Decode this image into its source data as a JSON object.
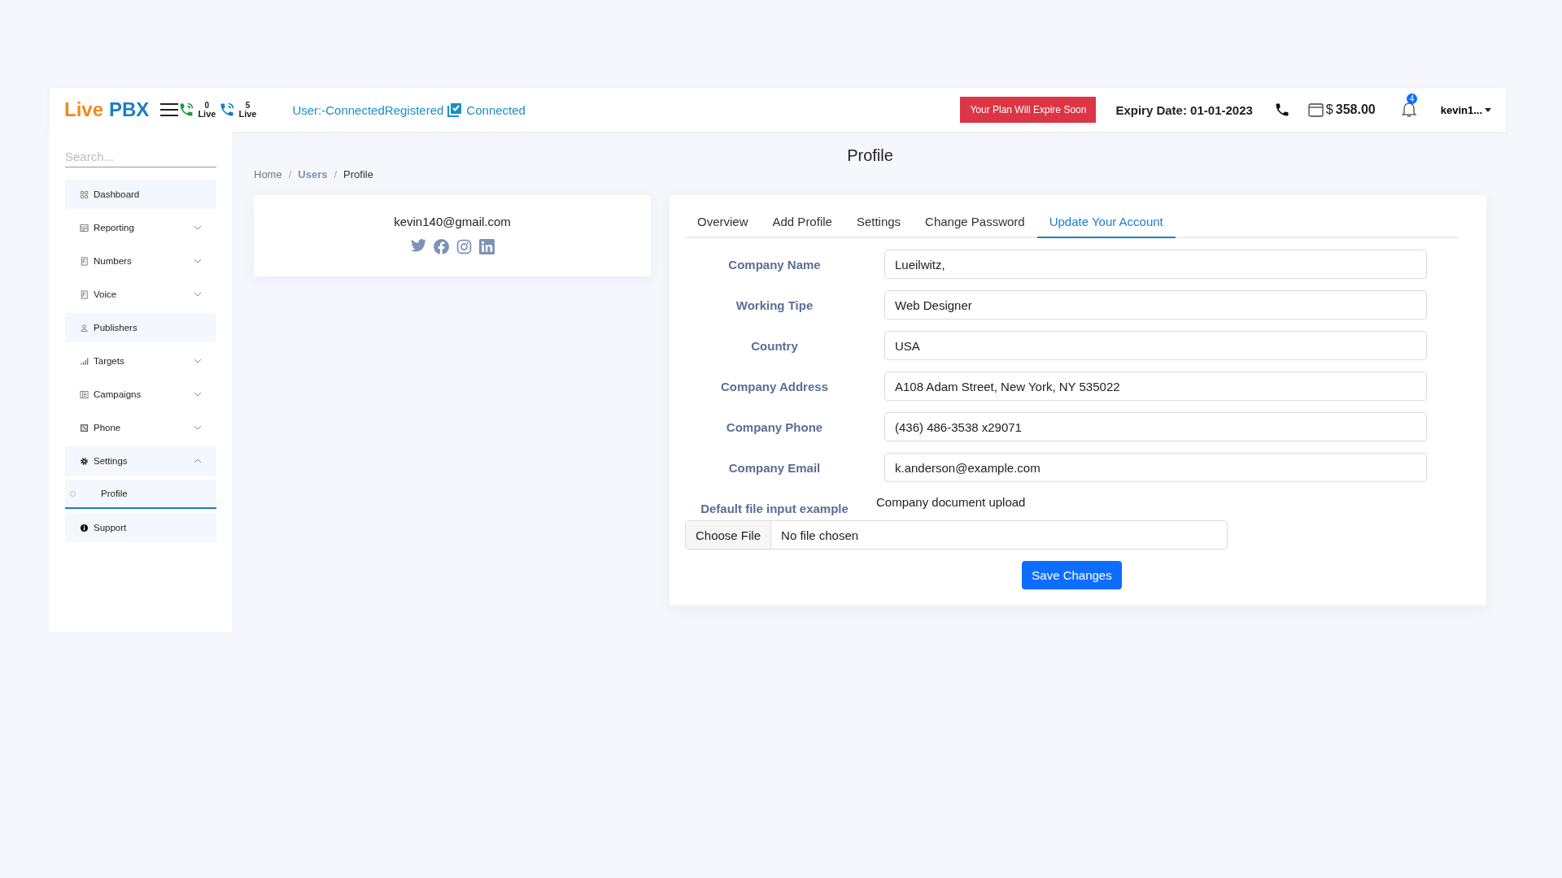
{
  "header": {
    "logo": {
      "first": "Live",
      "second": "PBX"
    },
    "live_counters": [
      {
        "count": "0",
        "label": "Live"
      },
      {
        "count": "5",
        "label": "Live"
      }
    ],
    "status": {
      "user": "User:-ConnectedRegistered",
      "connection": "Connected",
      "connected": true
    },
    "plan_button": "Your Plan Will Expire Soon",
    "expiry": "Expiry Date: 01-01-2023",
    "balance": {
      "currency": "$",
      "amount": "358.00"
    },
    "notifications": "4",
    "user": "kevin1..."
  },
  "sidebar": {
    "search": {
      "placeholder": "Search..."
    },
    "items": [
      {
        "label": "Dashboard",
        "kind": "link"
      },
      {
        "label": "Reporting",
        "kind": "group",
        "expanded": false
      },
      {
        "label": "Numbers",
        "kind": "group",
        "expanded": false
      },
      {
        "label": "Voice",
        "kind": "group",
        "expanded": false
      },
      {
        "label": "Publishers",
        "kind": "link"
      },
      {
        "label": "Targets",
        "kind": "group",
        "expanded": false
      },
      {
        "label": "Campaigns",
        "kind": "group",
        "expanded": false
      },
      {
        "label": "Phone",
        "kind": "group",
        "expanded": false
      },
      {
        "label": "Settings",
        "kind": "group",
        "expanded": true,
        "children": [
          {
            "label": "Profile",
            "selected": true
          }
        ]
      },
      {
        "label": "Support",
        "kind": "link"
      }
    ]
  },
  "page": {
    "title": "Profile",
    "breadcrumb": [
      {
        "label": "Home",
        "kind": "plain"
      },
      {
        "label": "/",
        "kind": "separator"
      },
      {
        "label": "Users",
        "kind": "link"
      },
      {
        "label": "/",
        "kind": "separator"
      },
      {
        "label": "Profile",
        "kind": "current"
      }
    ]
  },
  "profile_card": {
    "email": "kevin140@gmail.com"
  },
  "account": {
    "tabs": [
      {
        "label": "Overview",
        "selected": false
      },
      {
        "label": "Add Profile",
        "selected": false
      },
      {
        "label": "Settings",
        "selected": false
      },
      {
        "label": "Change Password",
        "selected": false
      },
      {
        "label": "Update Your Account",
        "selected": true
      }
    ],
    "fields": [
      {
        "label": "Company Name",
        "value": "Lueilwitz,"
      },
      {
        "label": "Working Tipe",
        "value": "Web Designer"
      },
      {
        "label": "Country",
        "value": "USA"
      },
      {
        "label": "Company Address",
        "value": "A108 Adam Street, New York, NY 535022"
      },
      {
        "label": "Company Phone",
        "value": "(436) 486-3538 x29071"
      },
      {
        "label": "Company Email",
        "value": "k.anderson@example.com"
      }
    ],
    "file_input": {
      "label": "Default file input example",
      "caption": "Company document upload",
      "button": "Choose File",
      "status": "No file chosen"
    },
    "save_button": "Save Changes"
  }
}
